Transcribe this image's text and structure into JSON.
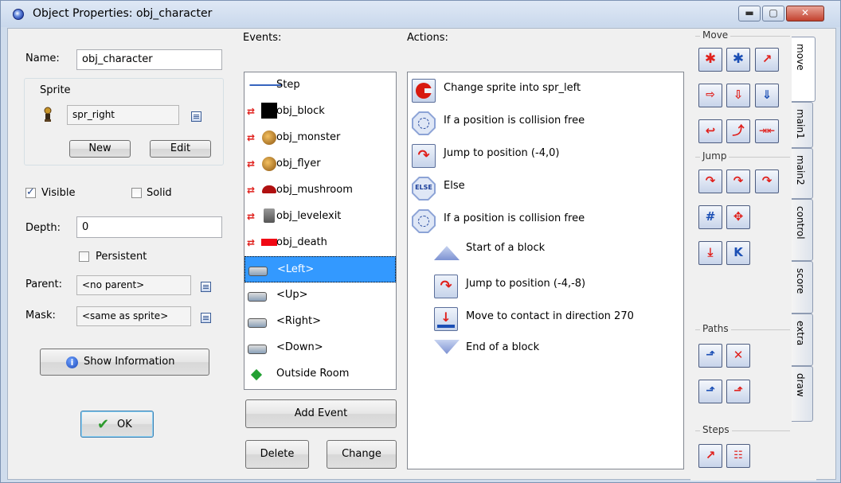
{
  "window": {
    "title": "Object Properties: obj_character",
    "min_symbol": "▬",
    "max_symbol": "▢",
    "close_symbol": "✕"
  },
  "left": {
    "name_label": "Name:",
    "name_value": "obj_character",
    "sprite_group_label": "Sprite",
    "sprite_value": "spr_right",
    "new_label": "New",
    "edit_label": "Edit",
    "visible_label": "Visible",
    "visible_checked": true,
    "solid_label": "Solid",
    "solid_checked": false,
    "depth_label": "Depth:",
    "depth_value": "0",
    "persistent_label": "Persistent",
    "persistent_checked": false,
    "parent_label": "Parent:",
    "parent_value": "<no parent>",
    "mask_label": "Mask:",
    "mask_value": "<same as sprite>",
    "show_info_label": "Show Information",
    "ok_label": "OK"
  },
  "events": {
    "header": "Events:",
    "items": [
      {
        "label": "Step",
        "icon": "step-icon"
      },
      {
        "label": "obj_block",
        "icon": "collision-block-icon"
      },
      {
        "label": "obj_monster",
        "icon": "collision-monster-icon"
      },
      {
        "label": "obj_flyer",
        "icon": "collision-flyer-icon"
      },
      {
        "label": "obj_mushroom",
        "icon": "collision-mushroom-icon"
      },
      {
        "label": "obj_levelexit",
        "icon": "collision-levelexit-icon"
      },
      {
        "label": "obj_death",
        "icon": "collision-death-icon"
      },
      {
        "label": "<Left>",
        "icon": "keyboard-icon",
        "selected": true
      },
      {
        "label": "<Up>",
        "icon": "keyboard-icon"
      },
      {
        "label": "<Right>",
        "icon": "keyboard-icon"
      },
      {
        "label": "<Down>",
        "icon": "keyboard-icon"
      },
      {
        "label": "Outside Room",
        "icon": "outside-room-icon"
      }
    ],
    "add_label": "Add Event",
    "delete_label": "Delete",
    "change_label": "Change"
  },
  "actions": {
    "header": "Actions:",
    "items": [
      {
        "label": "Change sprite into spr_left",
        "icon": "change-sprite-icon"
      },
      {
        "label": "If a position is collision free",
        "icon": "collision-free-icon"
      },
      {
        "label": "Jump to position (-4,0)",
        "icon": "jump-position-icon"
      },
      {
        "label": "Else",
        "icon": "else-icon"
      },
      {
        "label": "If a position is collision free",
        "icon": "collision-free-icon"
      },
      {
        "label": "Start of a block",
        "icon": "start-block-icon"
      },
      {
        "label": "Jump to position (-4,-8)",
        "icon": "jump-position-icon"
      },
      {
        "label": "Move to contact in direction 270",
        "icon": "move-contact-icon"
      },
      {
        "label": "End of a block",
        "icon": "end-block-icon"
      }
    ]
  },
  "library": {
    "sections": [
      "Move",
      "Jump",
      "Paths",
      "Steps"
    ],
    "tabs": [
      "move",
      "main1",
      "main2",
      "control",
      "score",
      "extra",
      "draw"
    ],
    "else_text": "ELSE"
  },
  "colors": {
    "selection": "#3399ff",
    "collision_red": "#e0201c",
    "action_blue": "#1b4fb5"
  }
}
